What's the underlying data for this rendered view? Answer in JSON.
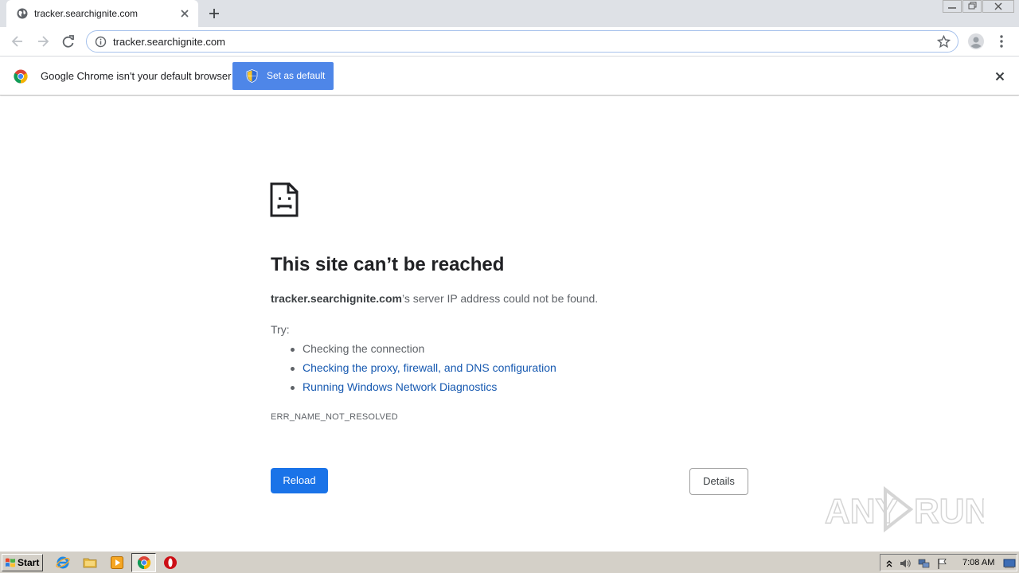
{
  "browser": {
    "tab_title": "tracker.searchignite.com",
    "url": "tracker.searchignite.com"
  },
  "infobar": {
    "message": "Google Chrome isn't your default browser",
    "button_label": "Set as default"
  },
  "error_page": {
    "heading": "This site can’t be reached",
    "host": "tracker.searchignite.com",
    "summary_rest": "’s server IP address could not be found.",
    "try_label": "Try:",
    "suggestions": [
      "Checking the connection",
      "Checking the proxy, firewall, and DNS configuration",
      "Running Windows Network Diagnostics"
    ],
    "error_code": "ERR_NAME_NOT_RESOLVED",
    "reload_label": "Reload",
    "details_label": "Details"
  },
  "taskbar": {
    "start_label": "Start",
    "clock": "7:08 AM",
    "pinned": [
      "internet-explorer-icon",
      "folder-icon",
      "media-player-icon",
      "chrome-icon",
      "opera-icon"
    ],
    "tray": [
      "chevron-up-icon",
      "volume-icon",
      "network-icon",
      "flag-icon",
      "desktop-icon"
    ]
  },
  "watermark": "ANY RUN",
  "colors": {
    "primary_button": "#1a73e8",
    "infobar_button": "#4e86e8",
    "link": "#1558b0",
    "tabstrip": "#dee1e6",
    "taskbar": "#d4d0c8"
  }
}
